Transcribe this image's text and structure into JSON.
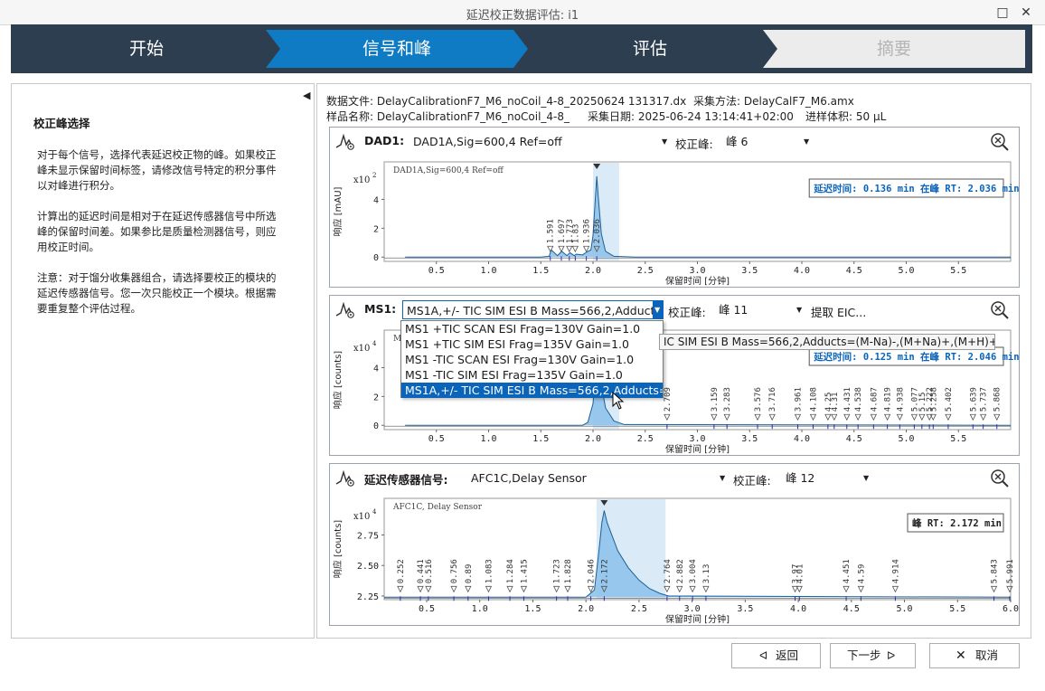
{
  "window": {
    "title": "延迟校正数据评估: i1",
    "maximize_icon": "□",
    "close_icon": "✕"
  },
  "wizard": {
    "steps": [
      {
        "label": "开始",
        "state": "done"
      },
      {
        "label": "信号和峰",
        "state": "active"
      },
      {
        "label": "评估",
        "state": "todo"
      },
      {
        "label": "摘要",
        "state": "inactive"
      }
    ],
    "colors": {
      "dark": "#2d3e50",
      "active": "#0f7bc5",
      "inactive": "#ececec"
    }
  },
  "help": {
    "title": "校正峰选择",
    "p1": [
      "对于每个信号，选择代表延迟校正物的峰。如果校正",
      "峰未显示保留时间标签，请修改信号特定的积分事件",
      "以对峰进行积分。"
    ],
    "p2": [
      "计算出的延迟时间是相对于在延迟传感器信号中所选",
      "峰的保留时间差。如果参比是质量检测器信号，则应",
      "用校正时间。"
    ],
    "p3": [
      "注意：对于馏分收集器组合，请选择要校正的模块的",
      "延迟传感器信号。您一次只能校正一个模块。根据需",
      "要重复整个评估过程。"
    ]
  },
  "file_info": {
    "data_file": "数据文件: DelayCalibrationF7_M6_noCoil_4-8_20250624 131317.dx",
    "method": "采集方法:  DelayCalF7_M6.amx",
    "sample": "样品名称: DelayCalibrationF7_M6_noCoil_4-8_",
    "date": "采集日期: 2025-06-24 13:14:41+02:00",
    "volume": "进样体积: 50 µL"
  },
  "common": {
    "peak_label": "校正峰:",
    "xlabel": "保留时间 [分钟]",
    "zoom_icon": "magnifier-minus"
  },
  "panels": {
    "dad": {
      "label": "DAD1:",
      "signal": "DAD1A,Sig=600,4  Ref=off",
      "peak": "峰 6",
      "chart_title": "DAD1A,Sig=600,4 Ref=off",
      "exp": "x10",
      "exp_power": "2",
      "ylabel": "响应 [mAU]",
      "note": "延迟时间: 0.136 min 在峰 RT: 2.036 min"
    },
    "ms": {
      "label": "MS1:",
      "signal": "MS1A,+/- TIC SIM ESI B Mass=566,2,Adducts",
      "peak": "峰 11",
      "extract": "提取 EIC...",
      "chart_title": "MS",
      "exp": "x10",
      "exp_power": "4",
      "ylabel": "响应 [counts]",
      "note": "延迟时间: 0.125 min 在峰 RT: 2.046 min"
    },
    "sensor": {
      "label": "延迟传感器信号:",
      "signal": "AFC1C,Delay Sensor",
      "peak": "峰 12",
      "chart_title": "AFC1C, Delay Sensor",
      "exp": "x10",
      "exp_power": "4",
      "ylabel": "响应 [counts]",
      "note": "峰 RT: 2.172 min"
    }
  },
  "dropdown": {
    "items": [
      "MS1 +TIC SCAN ESI Frag=130V Gain=1.0",
      "MS1 +TIC SIM ESI Frag=135V Gain=1.0",
      "MS1 -TIC SCAN ESI Frag=130V Gain=1.0",
      "MS1 -TIC SIM ESI Frag=135V Gain=1.0",
      "MS1A,+/- TIC SIM ESI B Mass=566,2,Adducts=(M"
    ],
    "selected_index": 4
  },
  "tooltip": "IC SIM ESI B Mass=566,2,Adducts=(M-Na)-,(M+Na)+,(M+H)+",
  "buttons": {
    "back": "返回",
    "next": "下一步",
    "cancel": "取消"
  },
  "chart_data": [
    {
      "type": "line",
      "title": "DAD1A,Sig=600,4 Ref=off",
      "xlabel": "保留时间 [分钟]",
      "ylabel": "响应 [mAU]",
      "y_exponent": "x10^2",
      "xlim": [
        0,
        6
      ],
      "ylim": [
        -0.3,
        6.6
      ],
      "xticks": [
        "0.5",
        "1.0",
        "1.5",
        "2.0",
        "2.5",
        "3.0",
        "3.5",
        "4.0",
        "4.5",
        "5.0",
        "5.5"
      ],
      "yticks": [
        "0",
        "2",
        "4"
      ],
      "peak_labels": [
        {
          "rt": 1.591,
          "label": "1.591"
        },
        {
          "rt": 1.697,
          "label": "1.697"
        },
        {
          "rt": 1.773,
          "label": "1.773"
        },
        {
          "rt": 1.83,
          "label": "1.83"
        },
        {
          "rt": 1.936,
          "label": "1.936"
        },
        {
          "rt": 2.036,
          "label": "2.036"
        }
      ],
      "selected_peak": {
        "rt": 2.036,
        "span": [
          2.0,
          2.25
        ]
      },
      "series": [
        {
          "x": [
            0.2,
            1.5,
            1.58,
            1.6,
            1.66,
            1.7,
            1.75,
            1.78,
            1.82,
            1.84,
            1.9,
            1.94,
            1.98,
            2.0,
            2.02,
            2.036,
            2.05,
            2.08,
            2.12,
            2.2,
            2.4,
            6.0
          ],
          "y": [
            0,
            0,
            0.05,
            0.5,
            0.1,
            0.4,
            0.1,
            0.3,
            0.1,
            0.2,
            0.15,
            0.35,
            0.5,
            1.5,
            3.8,
            5.6,
            4.2,
            1.6,
            0.4,
            0.05,
            0,
            0
          ]
        }
      ]
    },
    {
      "type": "line",
      "title": "MS",
      "xlabel": "保留时间 [分钟]",
      "ylabel": "响应 [counts]",
      "y_exponent": "x10^4",
      "xlim": [
        0,
        6
      ],
      "ylim": [
        -0.3,
        6.6
      ],
      "xticks": [
        "0.5",
        "1.0",
        "1.5",
        "2.0",
        "2.5",
        "3.0",
        "3.5",
        "4.0",
        "4.5",
        "5.0",
        "5.5"
      ],
      "yticks": [
        "0",
        "2",
        "4"
      ],
      "peak_labels": [
        {
          "rt": 2.709,
          "label": "2.709"
        },
        {
          "rt": 3.159,
          "label": "3.159"
        },
        {
          "rt": 3.283,
          "label": "3.283"
        },
        {
          "rt": 3.576,
          "label": "3.576"
        },
        {
          "rt": 3.716,
          "label": "3.716"
        },
        {
          "rt": 3.961,
          "label": "3.961"
        },
        {
          "rt": 4.108,
          "label": "4.108"
        },
        {
          "rt": 4.25,
          "label": "4.25"
        },
        {
          "rt": 4.31,
          "label": "4.31"
        },
        {
          "rt": 4.431,
          "label": "4.431"
        },
        {
          "rt": 4.538,
          "label": "4.538"
        },
        {
          "rt": 4.687,
          "label": "4.687"
        },
        {
          "rt": 4.819,
          "label": "4.819"
        },
        {
          "rt": 4.938,
          "label": "4.938"
        },
        {
          "rt": 5.077,
          "label": "5.077"
        },
        {
          "rt": 5.15,
          "label": "5.15"
        },
        {
          "rt": 5.222,
          "label": "5.222"
        },
        {
          "rt": 5.258,
          "label": "5.258"
        },
        {
          "rt": 5.402,
          "label": "5.402"
        },
        {
          "rt": 5.639,
          "label": "5.639"
        },
        {
          "rt": 5.737,
          "label": "5.737"
        },
        {
          "rt": 5.868,
          "label": "5.868"
        }
      ],
      "selected_peak": {
        "rt": 2.046,
        "span": [
          2.0,
          2.25
        ]
      },
      "series": [
        {
          "x": [
            0.2,
            1.9,
            1.95,
            2.0,
            2.02,
            2.046,
            2.07,
            2.12,
            2.2,
            2.3,
            6.0
          ],
          "y": [
            0,
            0,
            0.2,
            1.5,
            3.5,
            4.6,
            3.2,
            1.2,
            0.3,
            0.05,
            0
          ]
        }
      ]
    },
    {
      "type": "line",
      "title": "AFC1C, Delay Sensor",
      "xlabel": "保留时间 [分钟]",
      "ylabel": "响应 [counts]",
      "y_exponent": "x10^4",
      "xlim": [
        0.1,
        6.0
      ],
      "ylim": [
        2.22,
        3.05
      ],
      "xticks": [
        "0.5",
        "1.0",
        "1.5",
        "2.0",
        "2.5",
        "3.0",
        "3.5",
        "4.0",
        "4.5",
        "5.0",
        "5.5",
        "6.0"
      ],
      "yticks": [
        "2.25",
        "2.50",
        "2.75"
      ],
      "peak_labels": [
        {
          "rt": 0.252,
          "label": "0.252"
        },
        {
          "rt": 0.441,
          "label": "0.441"
        },
        {
          "rt": 0.516,
          "label": "0.516"
        },
        {
          "rt": 0.756,
          "label": "0.756"
        },
        {
          "rt": 0.89,
          "label": "0.89"
        },
        {
          "rt": 1.083,
          "label": "1.083"
        },
        {
          "rt": 1.284,
          "label": "1.284"
        },
        {
          "rt": 1.415,
          "label": "1.415"
        },
        {
          "rt": 1.723,
          "label": "1.723"
        },
        {
          "rt": 1.828,
          "label": "1.828"
        },
        {
          "rt": 2.046,
          "label": "2.046"
        },
        {
          "rt": 2.172,
          "label": "2.172"
        },
        {
          "rt": 2.764,
          "label": "2.764"
        },
        {
          "rt": 2.882,
          "label": "2.882"
        },
        {
          "rt": 3.004,
          "label": "3.004"
        },
        {
          "rt": 3.13,
          "label": "3.13"
        },
        {
          "rt": 3.97,
          "label": "3.97"
        },
        {
          "rt": 4.01,
          "label": "4.01"
        },
        {
          "rt": 4.451,
          "label": "4.451"
        },
        {
          "rt": 4.59,
          "label": "4.59"
        },
        {
          "rt": 4.914,
          "label": "4.914"
        },
        {
          "rt": 5.843,
          "label": "5.843"
        },
        {
          "rt": 5.991,
          "label": "5.991"
        }
      ],
      "selected_peak": {
        "rt": 2.172,
        "span": [
          2.1,
          2.75
        ]
      },
      "series": [
        {
          "x": [
            0.1,
            2.0,
            2.08,
            2.12,
            2.15,
            2.172,
            2.2,
            2.3,
            2.4,
            2.5,
            2.6,
            2.7,
            2.78,
            6.0
          ],
          "y": [
            2.24,
            2.24,
            2.3,
            2.6,
            2.85,
            2.95,
            2.85,
            2.62,
            2.48,
            2.38,
            2.31,
            2.27,
            2.25,
            2.24
          ]
        }
      ]
    }
  ]
}
